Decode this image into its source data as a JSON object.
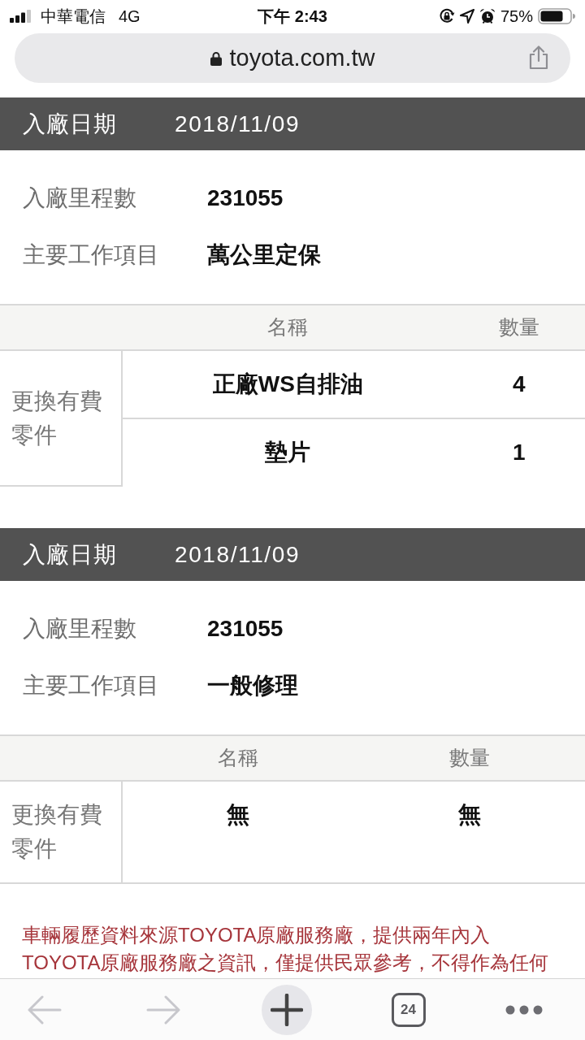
{
  "status_bar": {
    "carrier": "中華電信",
    "network": "4G",
    "time": "下午 2:43",
    "battery": "75%"
  },
  "address_bar": {
    "url": "toyota.com.tw"
  },
  "records": [
    {
      "date_label": "入廠日期",
      "date": "2018/11/09",
      "fields": [
        {
          "label": "入廠里程數",
          "value": "231055"
        },
        {
          "label": "主要工作項目",
          "value": "萬公里定保"
        }
      ],
      "parts": {
        "columns": [
          "名稱",
          "數量"
        ],
        "row_label": "更換有費零件",
        "rows": [
          {
            "name": "正廠WS自排油",
            "quantity": "4"
          },
          {
            "name": "墊片",
            "quantity": "1"
          }
        ]
      }
    },
    {
      "date_label": "入廠日期",
      "date": "2018/11/09",
      "fields": [
        {
          "label": "入廠里程數",
          "value": "231055"
        },
        {
          "label": "主要工作項目",
          "value": "一般修理"
        }
      ],
      "parts": {
        "columns": [
          "名稱",
          "數量"
        ],
        "row_label": "更換有費零件",
        "rows": [
          {
            "name": "無",
            "quantity": "無"
          }
        ]
      }
    }
  ],
  "disclaimer": "車輛履歷資料來源TOYOTA原廠服務廠，提供兩年內入TOYOTA原廠服務廠之資訊，僅提供民眾參考，不得作為任何",
  "toolbar": {
    "back": {
      "disabled": true
    },
    "forward": {
      "disabled": true
    },
    "tab_count": "24"
  }
}
